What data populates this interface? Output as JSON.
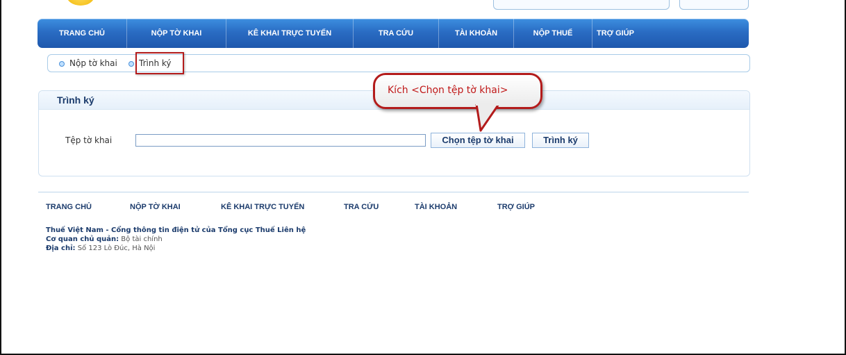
{
  "nav": {
    "items": [
      "TRANG CHỦ",
      "NỘP TỜ KHAI",
      "KÊ KHAI TRỰC TUYẾN",
      "TRA CỨU",
      "TÀI KHOẢN",
      "NỘP THUẾ",
      "TRỢ GIÚP"
    ]
  },
  "breadcrumb": {
    "items": [
      "Nộp tờ khai",
      "Trình ký"
    ]
  },
  "panel": {
    "title": "Trình ký",
    "field_label": "Tệp tờ khai",
    "file_value": "",
    "choose_button": "Chọn tệp tờ khai",
    "sign_button": "Trình ký"
  },
  "callout": {
    "text": "Kích <Chọn tệp tờ khai>"
  },
  "footer": {
    "links": [
      "TRANG CHỦ",
      "NỘP TỜ KHAI",
      "KÊ KHAI TRỰC TUYẾN",
      "TRA CỨU",
      "TÀI KHOẢN",
      "TRỢ GIÚP"
    ],
    "line1": "Thuế Việt Nam - Cổng thông tin điện tử của Tổng cục Thuế Liên hệ",
    "agency_label": "Cơ quan chủ quản:",
    "agency_value": "Bộ tài chính",
    "address_label": "Địa chỉ:",
    "address_value": "Số 123 Lò Đúc, Hà Nội"
  },
  "colors": {
    "nav_blue": "#2a6cc3",
    "callout_red": "#b31b1b",
    "title_navy": "#1a3a6b"
  }
}
